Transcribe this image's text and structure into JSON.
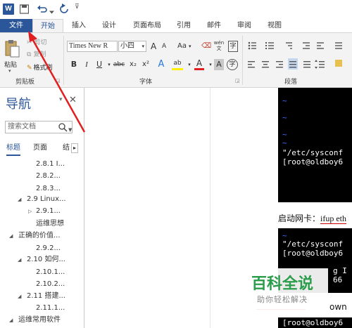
{
  "app": {
    "icon_letter": "W",
    "accent": "#2b579a"
  },
  "qat": {
    "save": "save-icon",
    "undo": "undo-icon",
    "redo": "redo-icon",
    "more": "⊽"
  },
  "tabs": [
    "文件",
    "开始",
    "插入",
    "设计",
    "页面布局",
    "引用",
    "邮件",
    "审阅",
    "视图"
  ],
  "ribbon": {
    "clipboard": {
      "paste": "粘贴",
      "cut": "剪切",
      "copy": "复制",
      "painter": "格式刷",
      "label": "剪贴板"
    },
    "font": {
      "name": "Times New R",
      "size": "小四",
      "label": "字体",
      "grow": "A",
      "shrink": "A",
      "case": "Aa",
      "bold": "B",
      "italic": "I",
      "underline": "U",
      "strike": "abc",
      "sub": "x₂",
      "sup": "x²",
      "effects": "A",
      "highlight": "ab",
      "color": "A",
      "charShade": "A",
      "enclose": "字",
      "wen": "wén 文"
    },
    "paragraph": {
      "label": "段落"
    }
  },
  "nav": {
    "title": "导航",
    "search_placeholder": "搜索文档",
    "tabs": [
      "标题",
      "页面",
      "结"
    ],
    "scroll": "▸",
    "items": [
      "2.8.1 I...",
      "2.8.2...",
      "2.8.3...",
      "2.9 Linux...",
      "2.9.1...",
      "运维思想",
      "正确的价值...",
      "2.9.2...",
      "2.10 如何...",
      "2.10.1...",
      "2.10.2...",
      "2.11 搭建...",
      "2.11.1...",
      "运维常用软件"
    ]
  },
  "doc": {
    "term1_lines": [
      "\"/etc/sysconf",
      "[root@oldboy6"
    ],
    "caption": "启动网卡：",
    "caption_cmd": "ifup eth",
    "term2_lines": [
      "\"/etc/sysconf",
      "[root@oldboy6",
      "",
      "g I",
      "66"
    ],
    "line_fragment": "own",
    "term3_lines": [
      "[root@oldboy6"
    ]
  },
  "watermark": {
    "title": "百科全说",
    "subtitle": "助你轻松解决"
  }
}
